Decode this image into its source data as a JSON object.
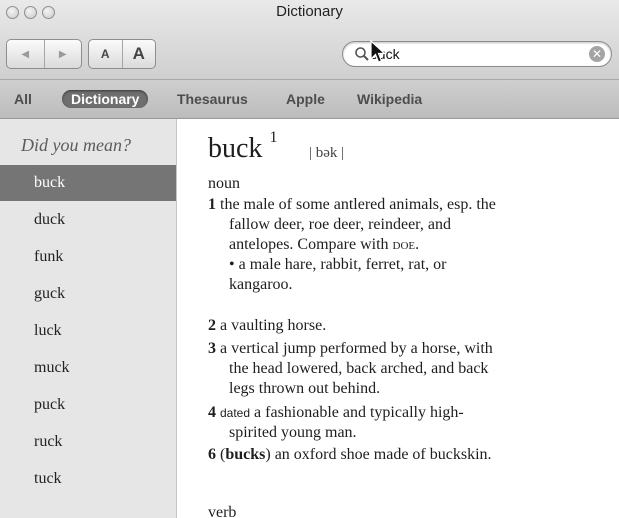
{
  "window": {
    "title": "Dictionary"
  },
  "toolbar": {
    "back_glyph": "◀",
    "forward_glyph": "▶",
    "font_smaller": "A",
    "font_larger": "A",
    "search_value": "buck",
    "clear_glyph": "✕"
  },
  "scope_tabs": [
    "All",
    "Dictionary",
    "Thesaurus",
    "Apple",
    "Wikipedia"
  ],
  "sidebar": {
    "header": "Did you mean?",
    "items": [
      "buck",
      "duck",
      "funk",
      "guck",
      "luck",
      "muck",
      "puck",
      "ruck",
      "tuck"
    ]
  },
  "entry": {
    "headword": "buck",
    "homograph": "1",
    "pronunciation": "| bək |",
    "pos_noun": "noun",
    "senses": {
      "s1_num": "1",
      "s1_line1": "the male of some antlered animals, esp. the",
      "s1_line2": "fallow deer, roe deer, reindeer, and",
      "s1_line3a": "antelopes. Compare with ",
      "s1_xref": "doe",
      "s1_line3b": ".",
      "s1_sub1": "• a male hare, rabbit, ferret, rat, or",
      "s1_sub2": "kangaroo.",
      "s2_num": "2",
      "s2_text": "a vaulting horse.",
      "s3_num": "3",
      "s3_line1": "a vertical jump performed by a horse, with",
      "s3_line2": "the head lowered, back arched, and back",
      "s3_line3": "legs thrown out behind.",
      "s4_num": "4",
      "s4_label": "dated",
      "s4_line1": " a fashionable and typically high-",
      "s4_line2": "spirited young man.",
      "s6_num": "6",
      "s6_open": "(",
      "s6_bold": "bucks",
      "s6_rest": ") an oxford shoe made of buckskin."
    },
    "pos_verb": "verb"
  },
  "colors": {
    "selected_bg": "#757575",
    "sidebar_bg": "#e6e6e6",
    "toolbar_bg": "#d9d9d9"
  }
}
